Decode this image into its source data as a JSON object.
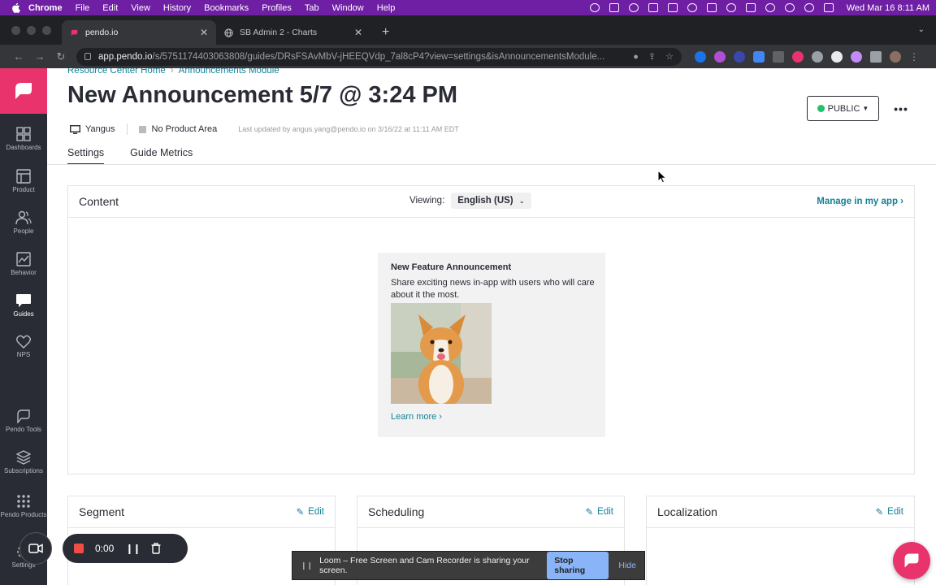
{
  "macos": {
    "menus": [
      "Chrome",
      "File",
      "Edit",
      "View",
      "History",
      "Bookmarks",
      "Profiles",
      "Tab",
      "Window",
      "Help"
    ],
    "clock": "Wed Mar 16  8:11 AM"
  },
  "browser": {
    "tabs": [
      {
        "title": "pendo.io",
        "active": true
      },
      {
        "title": "SB Admin 2 - Charts",
        "active": false
      }
    ],
    "url_host": "app.pendo.io",
    "url_path": "/s/5751174403063808/guides/DRsFSAvMbV-jHEEQVdp_7al8cP4?view=settings&isAnnouncementsModule..."
  },
  "nav": {
    "items": [
      "Dashboards",
      "Product",
      "People",
      "Behavior",
      "Guides",
      "NPS",
      "Pendo Tools",
      "Subscriptions",
      "Pendo Products",
      "Settings"
    ]
  },
  "breadcrumb": {
    "home": "Resource Center Home",
    "sep": "›",
    "current": "Announcements Module"
  },
  "page": {
    "title": "New Announcement 5/7 @ 3:24 PM",
    "app": "Yangus",
    "product_area": "No Product Area",
    "updated": "Last updated by angus.yang@pendo.io on 3/16/22 at 11:11 AM EDT",
    "tabs": [
      "Settings",
      "Guide Metrics"
    ],
    "status": "PUBLIC",
    "status_color": "#23c16b",
    "more": "•••"
  },
  "content_card": {
    "title": "Content",
    "viewing_label": "Viewing:",
    "language": "English (US)",
    "manage": "Manage in my app ›",
    "preview": {
      "heading": "New Feature Announcement",
      "body": "Share exciting news in-app with users who will care about it the most.",
      "link": "Learn more ›"
    }
  },
  "sections": [
    {
      "title": "Segment",
      "edit": "Edit"
    },
    {
      "title": "Scheduling",
      "edit": "Edit"
    },
    {
      "title": "Localization",
      "edit": "Edit"
    }
  ],
  "loom": {
    "timer": "0:00",
    "share_text": "Loom – Free Screen and Cam Recorder is sharing your screen.",
    "stop": "Stop sharing",
    "hide": "Hide"
  },
  "colors": {
    "brand": "#e8336c",
    "link": "#128297",
    "rail": "#2a2c35",
    "menubar": "#6f1fa3"
  }
}
